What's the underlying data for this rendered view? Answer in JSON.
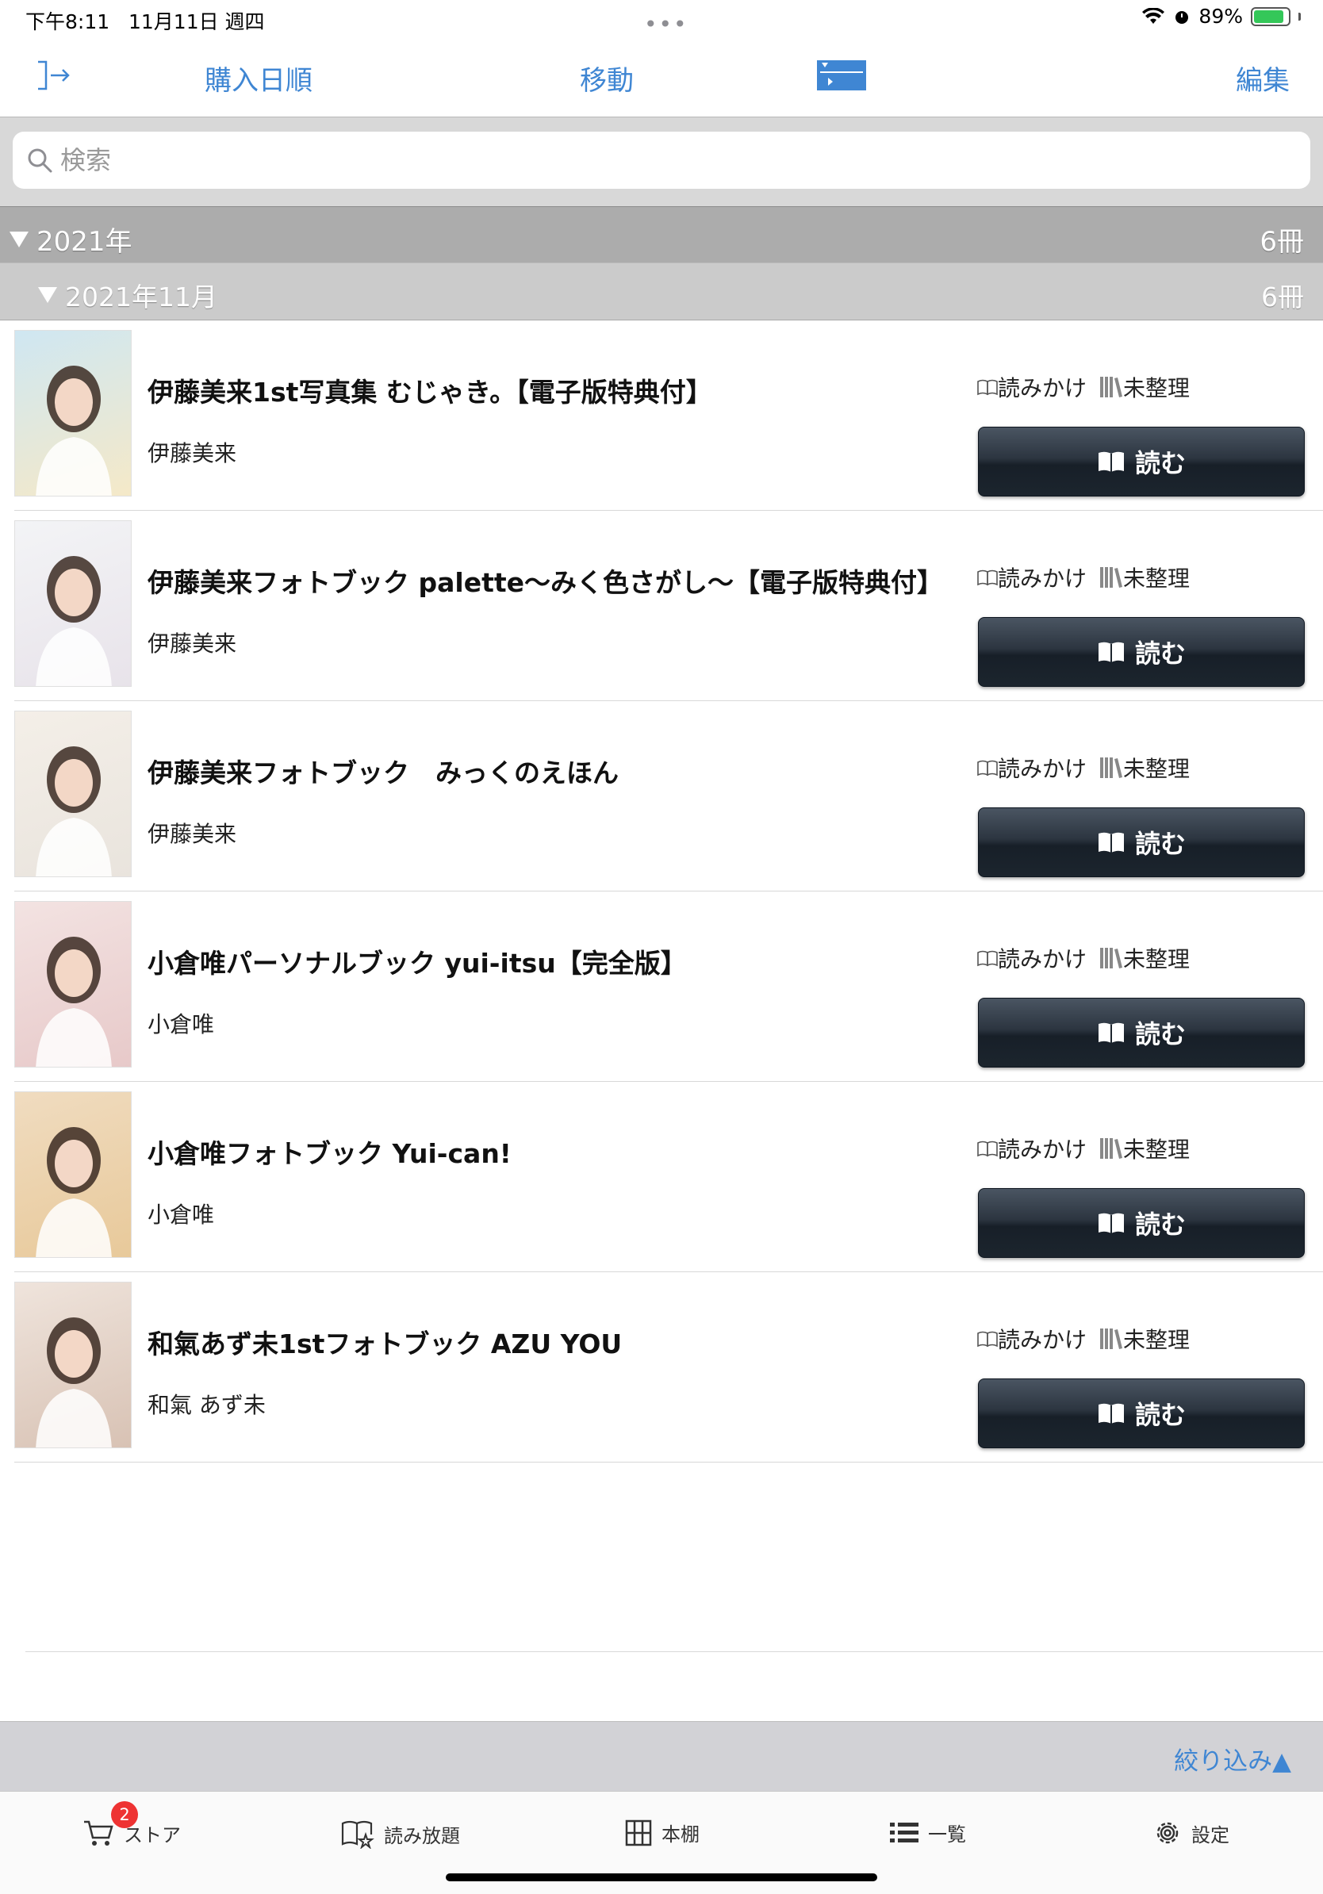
{
  "status_bar": {
    "time": "下午8:11",
    "date": "11月11日 週四",
    "battery": "89%",
    "battery_level": 0.89
  },
  "nav": {
    "exit_icon": "exit-arrow-icon",
    "sort_label": "購入日順",
    "move_label": "移動",
    "filter_toggle_icon": "filter-toggle-icon",
    "edit_label": "編集"
  },
  "search": {
    "placeholder": "検索"
  },
  "sections": {
    "year": {
      "label": "2021年",
      "count": "6冊"
    },
    "month": {
      "label": "2021年11月",
      "count": "6冊"
    }
  },
  "books": [
    {
      "title": "伊藤美来1st写真集 むじゃき。【電子版特典付】",
      "author": "伊藤美来",
      "reading_status": "読みかけ",
      "shelf_status": "未整理",
      "read_label": "読む",
      "cover_colors": [
        "#cfe7f2",
        "#f5e9c8"
      ]
    },
    {
      "title": "伊藤美来フォトブック palette～みく色さがし～【電子版特典付】",
      "author": "伊藤美来",
      "reading_status": "読みかけ",
      "shelf_status": "未整理",
      "read_label": "読む",
      "cover_colors": [
        "#f3f4f6",
        "#e8e3ea"
      ]
    },
    {
      "title": "伊藤美来フォトブック　みっくのえほん",
      "author": "伊藤美来",
      "reading_status": "読みかけ",
      "shelf_status": "未整理",
      "read_label": "読む",
      "cover_colors": [
        "#f4efe8",
        "#e9e4dd"
      ]
    },
    {
      "title": "小倉唯パーソナルブック yui-itsu【完全版】",
      "author": "小倉唯",
      "reading_status": "読みかけ",
      "shelf_status": "未整理",
      "read_label": "読む",
      "cover_colors": [
        "#f3e3e2",
        "#e7c9c9"
      ]
    },
    {
      "title": "小倉唯フォトブック Yui-can!",
      "author": "小倉唯",
      "reading_status": "読みかけ",
      "shelf_status": "未整理",
      "read_label": "読む",
      "cover_colors": [
        "#f0dcc0",
        "#e8c99a"
      ]
    },
    {
      "title": "和氣あず未1stフォトブック AZU YOU",
      "author": "和氣 あず未",
      "reading_status": "読みかけ",
      "shelf_status": "未整理",
      "read_label": "読む",
      "cover_colors": [
        "#efe4dc",
        "#d8c2b4"
      ]
    }
  ],
  "filter": {
    "label": "絞り込み▲"
  },
  "tabs": [
    {
      "label": "ストア",
      "icon": "cart-icon",
      "badge": "2"
    },
    {
      "label": "読み放題",
      "icon": "book-star-icon"
    },
    {
      "label": "本棚",
      "icon": "grid-icon"
    },
    {
      "label": "一覧",
      "icon": "list-icon"
    },
    {
      "label": "設定",
      "icon": "gear-icon"
    }
  ],
  "colors": {
    "accent": "#3f86d3",
    "read_button": "#1c252e",
    "section_year": "#acacac",
    "section_month": "#cbcbcb"
  }
}
